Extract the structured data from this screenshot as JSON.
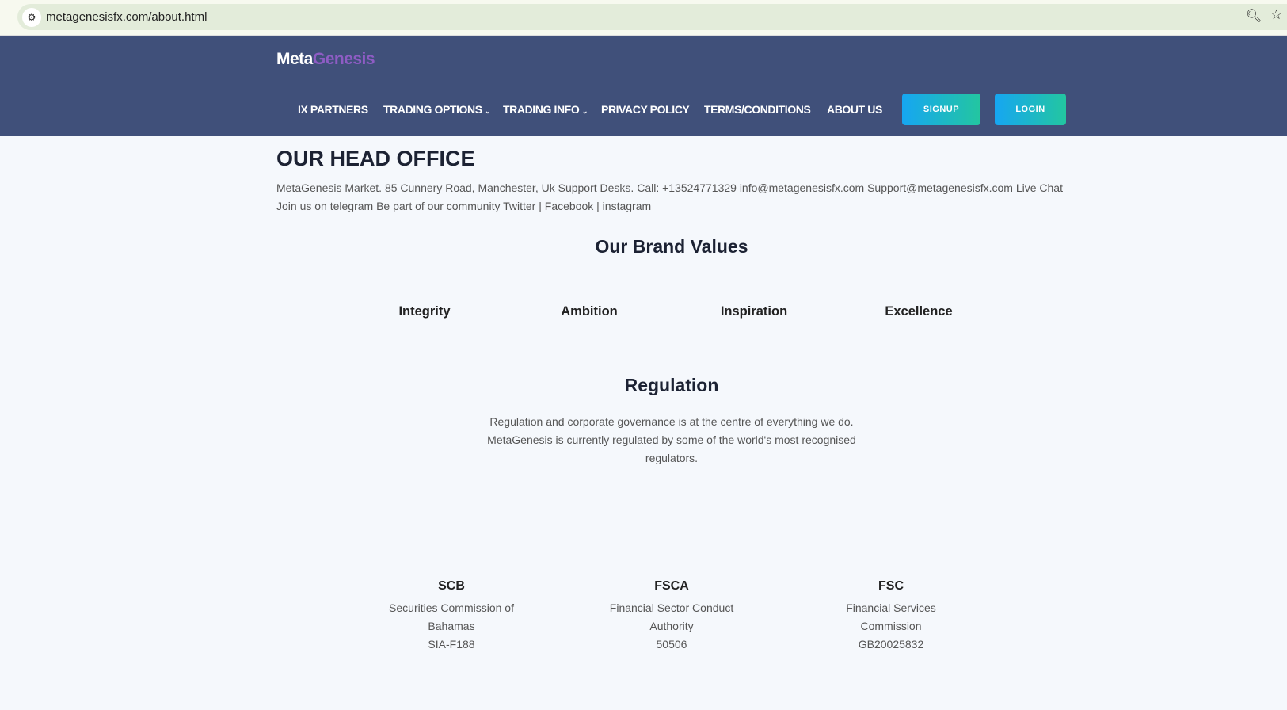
{
  "browser": {
    "url": "metagenesisfx.com/about.html"
  },
  "header": {
    "logo_part1": "Meta",
    "logo_part2": "Genesis",
    "nav": [
      "IX PARTNERS",
      "TRADING OPTIONS",
      "TRADING INFO",
      "PRIVACY POLICY",
      "TERMS/CONDITIONS",
      "ABOUT US"
    ],
    "signup": "SIGNUP",
    "login": "LOGIN"
  },
  "office": {
    "title": "OUR HEAD OFFICE",
    "line1": "MetaGenesis Market. 85 Cunnery Road, Manchester, Uk Support Desks. Call: +13524771329 info@metagenesisfx.com Support@metagenesisfx.com Live Chat",
    "line2_prefix": "Join us on telegram Be part of our community ",
    "twitter": "Twitter",
    "facebook": "Facebook",
    "instagram": "instagram",
    "sep": " | "
  },
  "values": {
    "title": "Our Brand Values",
    "items": [
      "Integrity",
      "Ambition",
      "Inspiration",
      "Excellence"
    ]
  },
  "regulation": {
    "title": "Regulation",
    "lines": [
      "Regulation and corporate governance is at the centre of everything we do.",
      "MetaGenesis is currently regulated by some of the world's most recognised",
      "regulators."
    ],
    "regulators": [
      {
        "abbr": "SCB",
        "name1": "Securities Commission of",
        "name2": "Bahamas",
        "id": "SIA-F188"
      },
      {
        "abbr": "FSCA",
        "name1": "Financial Sector Conduct",
        "name2": "Authority",
        "id": "50506"
      },
      {
        "abbr": "FSC",
        "name1": "Financial Services",
        "name2": "Commission",
        "id": "GB20025832"
      }
    ]
  }
}
